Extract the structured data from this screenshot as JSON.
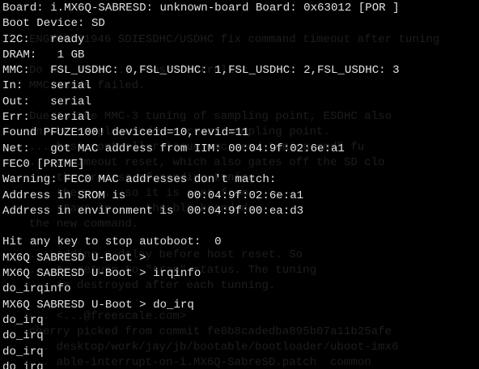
{
  "terminal": {
    "lines": [
      "Board: i.MX6Q-SABRESD: unknown-board Board: 0x63012 [POR ]",
      "Boot Device: SD",
      "I2C:   ready",
      "DRAM:   1 GB",
      "MMC:   FSL_USDHC: 0,FSL_USDHC: 1,FSL_USDHC: 2,FSL_USDHC: 3",
      "In:    serial",
      "Out:   serial",
      "Err:   serial",
      "Found PFUZE100! deviceid=10,revid=11",
      "Net:   got MAC address from IIM: 00:04:9f:02:6e:a1",
      "FEC0 [PRIME]",
      "Warning: FEC0 MAC addresses don't match:",
      "Address in SROM is         00:04:9f:02:6e:a1",
      "Address in environment is  00:04:9f:00:ea:d3",
      "",
      "Hit any key to stop autoboot:  0",
      "MX6Q SABRESD U-Boot >",
      "MX6Q SABRESD U-Boot > irqinfo",
      "do_irqinfo",
      "MX6Q SABRESD U-Boot > do_irq",
      "do_irq",
      "do_irq",
      "do_irq",
      "do_irq"
    ],
    "ghost_lines": [
      "",
      "",
      "    ENGR00281946 SDIESDHC/USDHC fix command timeout after tuning",
      "",
      "    Do not issue ... Host controller",
      "    MMC cards failed.",
      "",
      "    Due to the MMC-3 tuning of sampling point, ESDHC also",
      "    in the sample window current sampling point.",
      "    ... host controller issue mmc_send_tuning_cmd\" fu",
      "    ... a timeout reset, which also gates off the SD clo",
      "    ... the process of sending tuning",
      "    ... there ... so it is sent from",
      "    ... stays in ... the block and doe",
      "    the new command.",
      "",
      "    ... adding a delay before host reset. So",
      "    ... to return to \"tran\" status. The tuning",
      "    ... is destroyed after each tunning.",
      "",
      "    ... <...@freescale.com>",
      "    cherry picked from commit fe8b8cadedba895b07a11b25afe",
      "    ... desktop/work/jay/jb/bootable/bootloader/uboot-imx6",
      "    ... able-interrupt-on-i.MX6Q-SabreSD.patch  common"
    ]
  }
}
